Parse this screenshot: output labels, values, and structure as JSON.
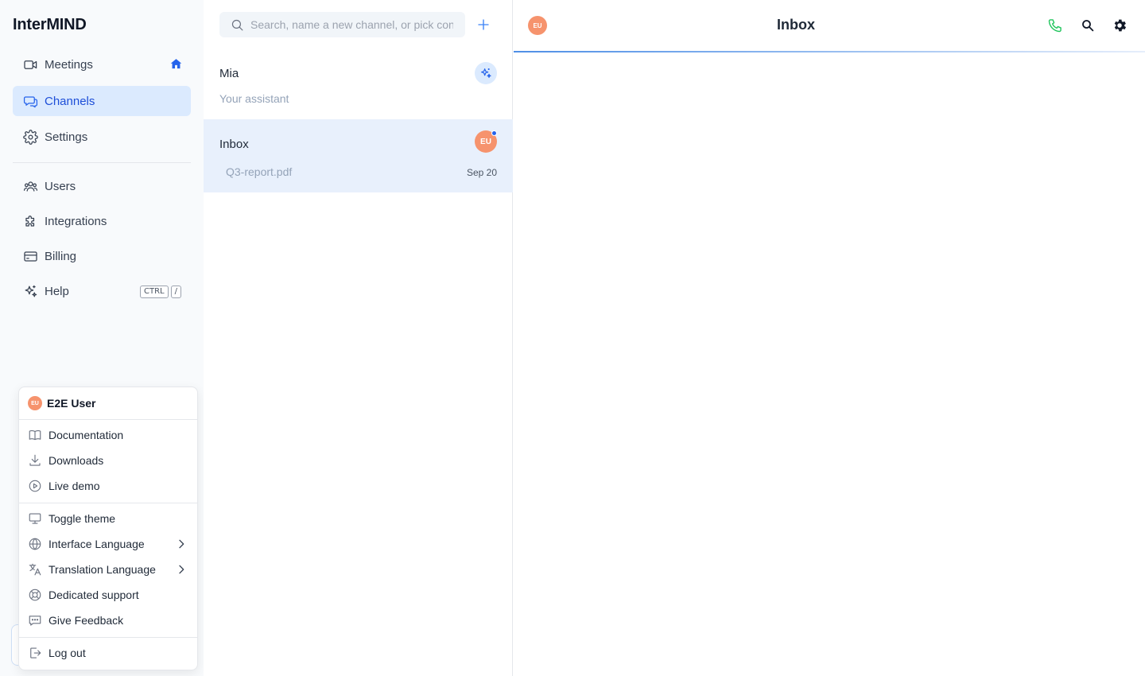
{
  "app": {
    "brand": "InterMIND"
  },
  "sidebar": {
    "primary": [
      {
        "label": "Meetings",
        "icon": "video-icon"
      },
      {
        "label": "Channels",
        "icon": "chat-bubbles-icon",
        "active": true
      },
      {
        "label": "Settings",
        "icon": "gear-icon"
      }
    ],
    "secondary": [
      {
        "label": "Users",
        "icon": "users-icon"
      },
      {
        "label": "Integrations",
        "icon": "puzzle-icon"
      },
      {
        "label": "Billing",
        "icon": "credit-card-icon"
      },
      {
        "label": "Help",
        "icon": "sparkles-icon",
        "shortcut": [
          "CTRL",
          "/"
        ]
      }
    ]
  },
  "user_menu": {
    "user_name": "E2E User",
    "initials": "EU",
    "group1": [
      {
        "label": "Documentation",
        "icon": "book-icon"
      },
      {
        "label": "Downloads",
        "icon": "download-icon"
      },
      {
        "label": "Live demo",
        "icon": "play-circle-icon"
      }
    ],
    "group2": [
      {
        "label": "Toggle theme",
        "icon": "monitor-icon"
      },
      {
        "label": "Interface Language",
        "icon": "globe-icon",
        "submenu": true
      },
      {
        "label": "Translation Language",
        "icon": "translate-icon",
        "submenu": true
      },
      {
        "label": "Dedicated support",
        "icon": "lifebuoy-icon"
      },
      {
        "label": "Give Feedback",
        "icon": "message-dots-icon"
      }
    ],
    "group3": [
      {
        "label": "Log out",
        "icon": "logout-icon"
      }
    ]
  },
  "channel_list": {
    "search_placeholder": "Search, name a new channel, or pick con",
    "items": [
      {
        "title": "Mia",
        "subtitle": "Your assistant"
      },
      {
        "title": "Inbox",
        "subtitle": "Q3-report.pdf",
        "date": "Sep 20",
        "initials": "EU",
        "selected": true,
        "unread": true
      }
    ]
  },
  "main": {
    "title": "Inbox",
    "initials": "EU"
  },
  "colors": {
    "accent": "#2563eb",
    "active_bg": "#dbeafe",
    "avatar": "#f6936d",
    "phone": "#22c55e"
  }
}
